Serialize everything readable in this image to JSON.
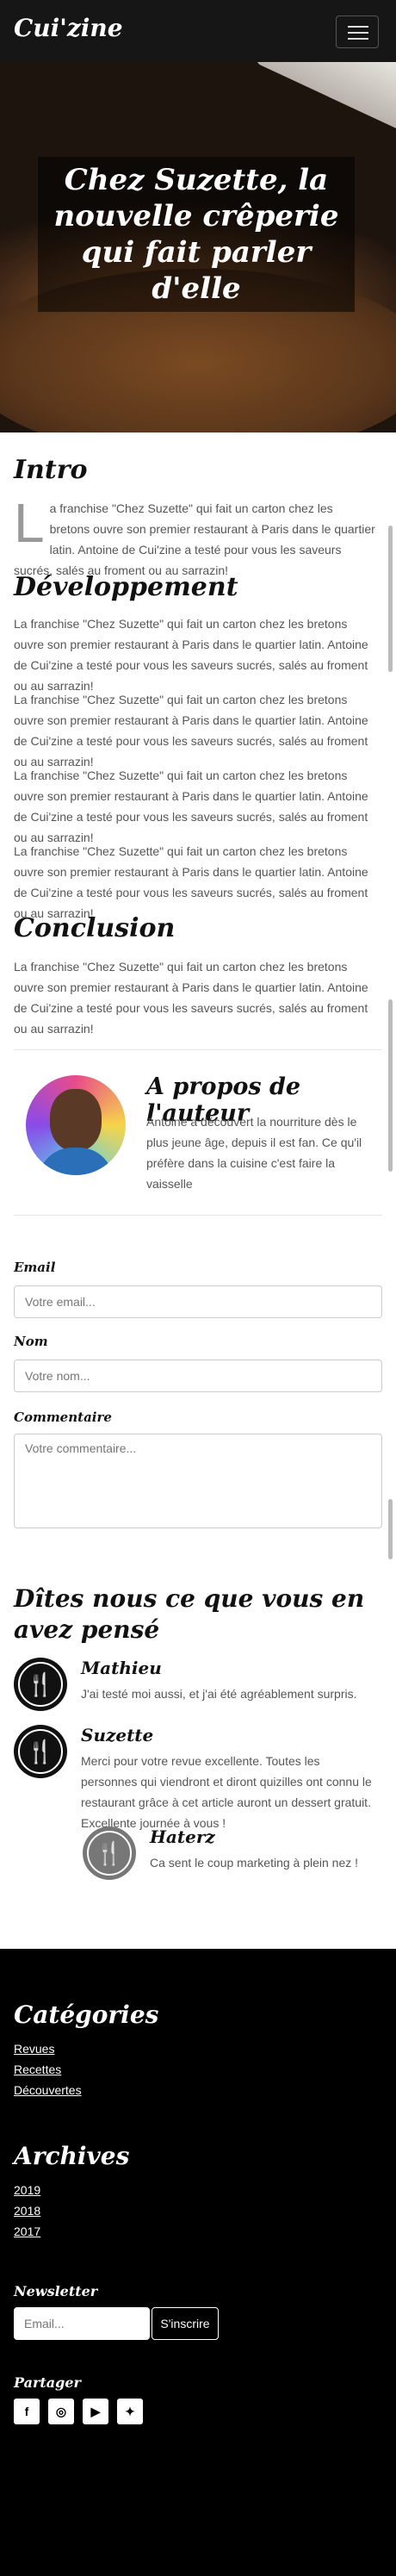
{
  "header": {
    "logo": "Cui'zine",
    "menu_icon": "hamburger-icon"
  },
  "hero": {
    "title": "Chez Suzette, la nouvelle crêperie qui fait parler d'elle"
  },
  "article": {
    "intro_title": "Intro",
    "intro_dropcap": "L",
    "intro_text": "a franchise \"Chez Suzette\" qui fait un carton chez les bretons ouvre son premier restaurant à Paris dans le quartier latin. Antoine de Cui'zine a testé pour vous les saveurs sucrés, salés au froment ou au sarrazin!",
    "dev_title": "Développement",
    "dev_paragraphs": [
      "La franchise \"Chez Suzette\" qui fait un carton chez les bretons ouvre son premier restaurant à Paris dans le quartier latin. Antoine de Cui'zine a testé pour vous les saveurs sucrés, salés au froment ou au sarrazin!",
      "La franchise \"Chez Suzette\" qui fait un carton chez les bretons ouvre son premier restaurant à Paris dans le quartier latin. Antoine de Cui'zine a testé pour vous les saveurs sucrés, salés au froment ou au sarrazin!",
      "La franchise \"Chez Suzette\" qui fait un carton chez les bretons ouvre son premier restaurant à Paris dans le quartier latin. Antoine de Cui'zine a testé pour vous les saveurs sucrés, salés au froment ou au sarrazin!",
      "La franchise \"Chez Suzette\" qui fait un carton chez les bretons ouvre son premier restaurant à Paris dans le quartier latin. Antoine de Cui'zine a testé pour vous les saveurs sucrés, salés au froment ou au sarrazin!"
    ],
    "conclusion_title": "Conclusion",
    "conclusion_text": "La franchise \"Chez Suzette\" qui fait un carton chez les bretons ouvre son premier restaurant à Paris dans le quartier latin. Antoine de Cui'zine a testé pour vous les saveurs sucrés, salés au froment ou au sarrazin!"
  },
  "author": {
    "title": "A propos de l'auteur",
    "bio": "Antoine a découvert la nourriture dès le plus jeune âge, depuis il est fan. Ce qu'il préfère dans la cuisine c'est faire la vaisselle"
  },
  "form": {
    "email_label": "Email",
    "email_placeholder": "Votre email...",
    "name_label": "Nom",
    "name_placeholder": "Votre nom...",
    "comment_label": "Commentaire",
    "comment_placeholder": "Votre commentaire..."
  },
  "comments": {
    "title": "Dîtes nous ce que vous en avez pensé",
    "icon": "utensils-icon",
    "items": [
      {
        "name": "Mathieu",
        "text": "J'ai testé moi aussi, et j'ai été agréablement surpris."
      },
      {
        "name": "Suzette",
        "text": "Merci pour votre revue excellente. Toutes les personnes qui viendront et diront quizilles ont connu le restaurant grâce à cet article auront un dessert gratuit. Excellente journée à vous !"
      },
      {
        "name": "Haterz",
        "text": "Ca sent le coup marketing à plein nez !"
      }
    ]
  },
  "footer": {
    "categories_title": "Catégories",
    "categories": [
      "Revues",
      "Recettes",
      "Découvertes"
    ],
    "archives_title": "Archives",
    "archives": [
      "2019",
      "2018",
      "2017"
    ],
    "newsletter_title": "Newsletter",
    "newsletter_placeholder": "Email...",
    "newsletter_button": "S'inscrire",
    "share_title": "Partager",
    "social": [
      {
        "icon": "facebook-icon",
        "glyph": "f"
      },
      {
        "icon": "instagram-icon",
        "glyph": "◎"
      },
      {
        "icon": "youtube-icon",
        "glyph": "▶"
      },
      {
        "icon": "twitter-icon",
        "glyph": "✦"
      }
    ]
  }
}
